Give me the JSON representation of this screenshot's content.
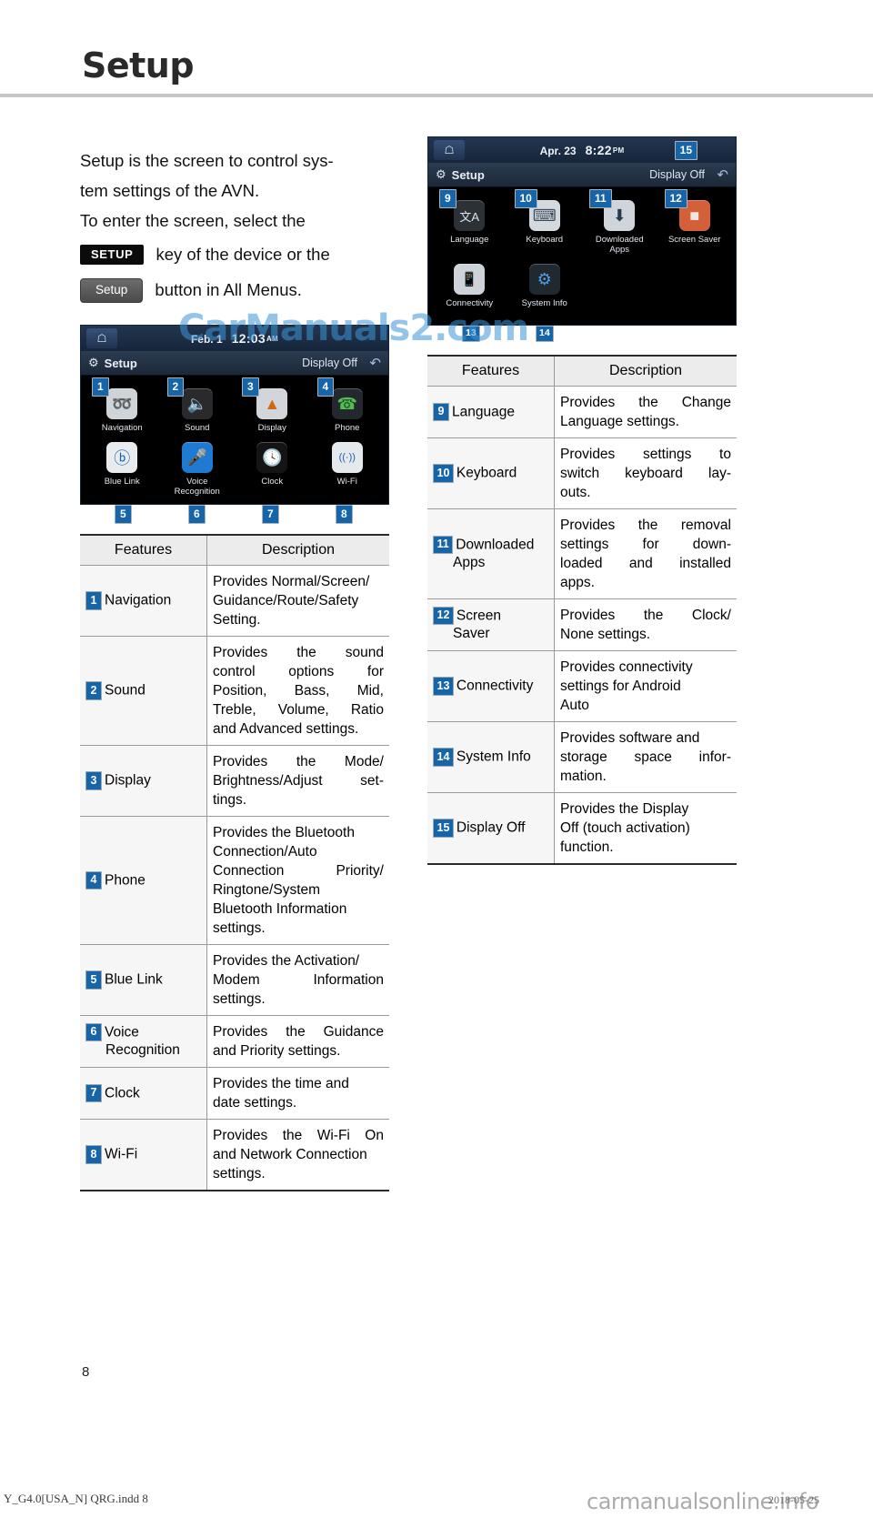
{
  "page": {
    "title": "Setup",
    "number": "8",
    "footer_file": "Y_G4.0[USA_N] QRG.indd   8",
    "footer_date": "2018-05-25",
    "watermark_main": "CarManuals2.com",
    "watermark_footer": "carmanualsonline.info",
    "accent_blue": "#1565a8"
  },
  "intro": {
    "line1": "Setup is the screen to control sys-",
    "line2": "tem settings of the AVN.",
    "line3": "To enter the screen, select the",
    "key_chip": "SETUP",
    "line4_after_key": "key of the device or the",
    "button_chip": "Setup",
    "line5_after_button": "button in All Menus."
  },
  "avn_left": {
    "status_date": "Feb.  1",
    "status_time": "12:03",
    "status_ampm": "AM",
    "home_icon": "home-icon",
    "gear_icon": "gear-icon",
    "title": "Setup",
    "display_off": "Display Off",
    "back_icon": "back-arrow-icon",
    "tiles": [
      {
        "callout": "1",
        "label": "Navigation",
        "icon": "compass-icon",
        "glyph": "⦿",
        "bg": "#cfd4d8",
        "fg": "#2b4f7a"
      },
      {
        "callout": "2",
        "label": "Sound",
        "icon": "speaker-icon",
        "glyph": "🔊",
        "bg": "#2a2a2c",
        "fg": "#d8dce0"
      },
      {
        "callout": "3",
        "label": "Display",
        "icon": "picture-icon",
        "glyph": "▲",
        "bg": "#d2d6da",
        "fg": "#d06a12"
      },
      {
        "callout": "4",
        "label": "Phone",
        "icon": "phone-icon",
        "glyph": "☎",
        "bg": "#23282e",
        "fg": "#4fbf4f"
      },
      {
        "callout": "5",
        "label": "Blue Link",
        "icon": "blue-link-icon",
        "glyph": "Ⓑ",
        "bg": "#e8ecef",
        "fg": "#1d5fa8"
      },
      {
        "callout": "6",
        "label": "Voice\nRecognition",
        "icon": "microphone-icon",
        "glyph": "🎤",
        "bg": "#1f7ad4",
        "fg": "#eaf2fb"
      },
      {
        "callout": "7",
        "label": "Clock",
        "icon": "clock-icon",
        "glyph": "🕓",
        "bg": "#141414",
        "fg": "#e6e6e6"
      },
      {
        "callout": "8",
        "label": "Wi-Fi",
        "icon": "wifi-icon",
        "glyph": "((·))",
        "bg": "#e4e9ee",
        "fg": "#1d5fa8"
      }
    ]
  },
  "avn_right": {
    "status_date": "Apr. 23",
    "status_time": "8:22",
    "status_ampm": "PM",
    "home_icon": "home-icon",
    "gear_icon": "gear-icon",
    "title": "Setup",
    "display_off": "Display Off",
    "display_off_callout": "15",
    "back_icon": "back-arrow-icon",
    "tiles": [
      {
        "callout": "9",
        "label": "Language",
        "icon": "language-icon",
        "glyph": "文A",
        "bg": "#2c3136",
        "fg": "#dbe3ea"
      },
      {
        "callout": "10",
        "label": "Keyboard",
        "icon": "keyboard-icon",
        "glyph": "⌨",
        "bg": "#d4d9de",
        "fg": "#3b4a5a"
      },
      {
        "callout": "11",
        "label": "Downloaded\nApps",
        "icon": "download-apps-icon",
        "glyph": "⬇",
        "bg": "#cfd5da",
        "fg": "#2b3a4a"
      },
      {
        "callout": "12",
        "label": "Screen Saver",
        "icon": "screen-saver-icon",
        "glyph": "■",
        "bg": "#d4603a",
        "fg": "#f1e6df"
      },
      {
        "callout": "13",
        "label": "Connectivity",
        "icon": "connectivity-icon",
        "glyph": "📱",
        "bg": "#cdd3d8",
        "fg": "#31404f"
      },
      {
        "callout": "14",
        "label": "System Info",
        "icon": "system-info-icon",
        "glyph": "⚙",
        "bg": "#202830",
        "fg": "#4f9fe0"
      }
    ]
  },
  "table_left": {
    "headers": {
      "features": "Features",
      "description": "Description"
    },
    "rows": [
      {
        "num": "1",
        "feature": "Navigation",
        "feature2": "",
        "desc_lines": [
          "Provides Normal/Screen/",
          "Guidance/Route/Safety",
          "Setting."
        ],
        "justify": [
          false,
          false,
          false
        ]
      },
      {
        "num": "2",
        "feature": "Sound",
        "feature2": "",
        "desc_lines": [
          "Provides the sound",
          "control options for",
          "Position, Bass, Mid,",
          "Treble, Volume, Ratio",
          "and Advanced settings."
        ],
        "justify": [
          true,
          true,
          true,
          true,
          false
        ]
      },
      {
        "num": "3",
        "feature": "Display",
        "feature2": "",
        "desc_lines": [
          "Provides the Mode/",
          "Brightness/Adjust set-",
          "tings."
        ],
        "justify": [
          true,
          true,
          false
        ]
      },
      {
        "num": "4",
        "feature": "Phone",
        "feature2": "",
        "desc_lines": [
          "Provides the Bluetooth",
          "Connection/Auto",
          "Connection Priority/",
          "Ringtone/System",
          "Bluetooth Information",
          "settings."
        ],
        "justify": [
          false,
          true,
          true,
          true,
          false,
          false
        ]
      },
      {
        "num": "5",
        "feature": "Blue Link",
        "feature2": "",
        "desc_lines": [
          "Provides the Activation/",
          "Modem Information",
          "settings."
        ],
        "justify": [
          false,
          true,
          false
        ]
      },
      {
        "num": "6",
        "feature": "Voice",
        "feature2": "Recognition",
        "desc_lines": [
          "Provides the Guidance",
          "and Priority settings."
        ],
        "justify": [
          true,
          false
        ]
      },
      {
        "num": "7",
        "feature": "Clock",
        "feature2": "",
        "desc_lines": [
          "Provides the time and",
          "date settings."
        ],
        "justify": [
          false,
          false
        ]
      },
      {
        "num": "8",
        "feature": "Wi-Fi",
        "feature2": "",
        "desc_lines": [
          "Provides the Wi-Fi On",
          "and Network Connection",
          "settings."
        ],
        "justify": [
          true,
          false,
          false
        ]
      }
    ]
  },
  "table_right": {
    "headers": {
      "features": "Features",
      "description": "Description"
    },
    "rows": [
      {
        "num": "9",
        "feature": "Language",
        "feature2": "",
        "desc_lines": [
          "Provides the Change",
          "Language settings."
        ],
        "justify": [
          true,
          false
        ]
      },
      {
        "num": "10",
        "feature": "Keyboard",
        "feature2": "",
        "desc_lines": [
          "Provides settings to",
          "switch keyboard lay-",
          "outs."
        ],
        "justify": [
          true,
          true,
          false
        ]
      },
      {
        "num": "11",
        "feature": "Downloaded",
        "feature2": "Apps",
        "desc_lines": [
          "Provides the removal",
          "settings for down-",
          "loaded and installed",
          "apps."
        ],
        "justify": [
          true,
          true,
          true,
          false
        ]
      },
      {
        "num": "12",
        "feature": "Screen",
        "feature2": "Saver",
        "desc_lines": [
          "Provides the Clock/",
          "None settings."
        ],
        "justify": [
          true,
          false
        ]
      },
      {
        "num": "13",
        "feature": "Connectivity",
        "feature2": "",
        "desc_lines": [
          "Provides connectivity",
          "settings for Android",
          "Auto"
        ],
        "justify": [
          false,
          false,
          false
        ]
      },
      {
        "num": "14",
        "feature": "System Info",
        "feature2": "",
        "desc_lines": [
          "Provides software and",
          "storage space infor-",
          "mation."
        ],
        "justify": [
          false,
          true,
          false
        ]
      },
      {
        "num": "15",
        "feature": "Display Off",
        "feature2": "",
        "desc_lines": [
          "Provides the Display",
          "Off (touch activation)",
          "function."
        ],
        "justify": [
          false,
          false,
          false
        ]
      }
    ]
  }
}
